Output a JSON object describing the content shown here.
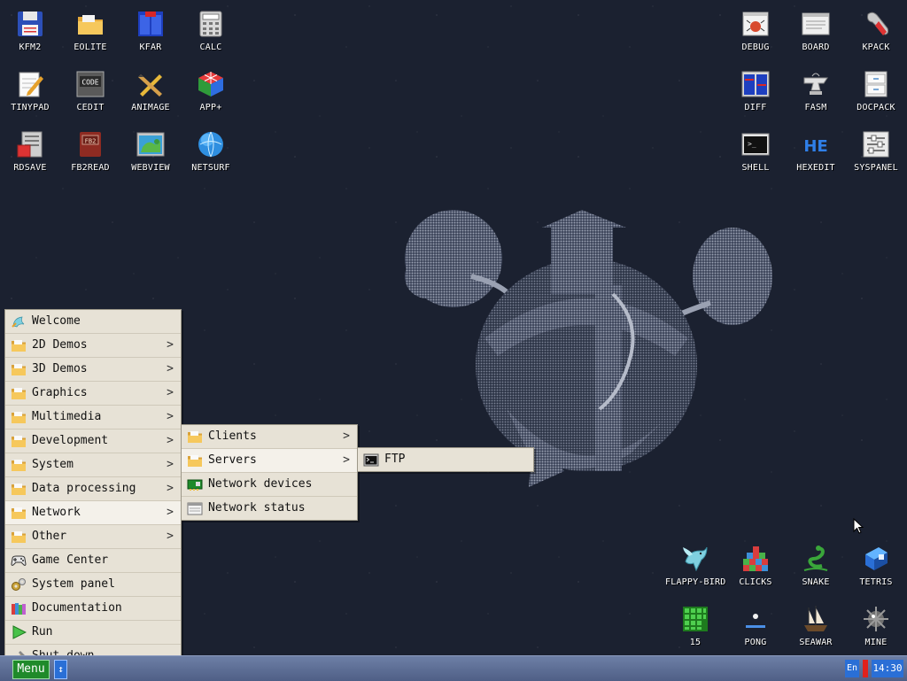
{
  "desktop_icons_left": [
    {
      "label": "KFM2",
      "icon": "floppy-icon",
      "name": "kfm2"
    },
    {
      "label": "EOLITE",
      "icon": "folder-icon",
      "name": "eolite"
    },
    {
      "label": "KFAR",
      "icon": "blue-panels-icon",
      "name": "kfar"
    },
    {
      "label": "CALC",
      "icon": "calculator-icon",
      "name": "calc"
    },
    {
      "label": "TINYPAD",
      "icon": "notepad-icon",
      "name": "tinypad"
    },
    {
      "label": "CEDIT",
      "icon": "code-icon",
      "name": "cedit"
    },
    {
      "label": "ANIMAGE",
      "icon": "pencil-ruler-icon",
      "name": "animage"
    },
    {
      "label": "APP+",
      "icon": "cube-icon",
      "name": "app-plus"
    },
    {
      "label": "RDSAVE",
      "icon": "ramdisk-save-icon",
      "name": "rdsave"
    },
    {
      "label": "FB2READ",
      "icon": "book-icon",
      "name": "fb2read"
    },
    {
      "label": "WEBVIEW",
      "icon": "web-map-icon",
      "name": "webview"
    },
    {
      "label": "NETSURF",
      "icon": "globe-icon",
      "name": "netsurf"
    }
  ],
  "desktop_icons_right": [
    {
      "label": "DEBUG",
      "icon": "bug-icon",
      "name": "debug"
    },
    {
      "label": "BOARD",
      "icon": "board-icon",
      "name": "board"
    },
    {
      "label": "KPACK",
      "icon": "wrench-icon",
      "name": "kpack"
    },
    {
      "label": "DIFF",
      "icon": "diff-icon",
      "name": "diff"
    },
    {
      "label": "FASM",
      "icon": "anvil-icon",
      "name": "fasm"
    },
    {
      "label": "DOCPACK",
      "icon": "cabinet-icon",
      "name": "docpack"
    },
    {
      "label": "SHELL",
      "icon": "terminal-icon",
      "name": "shell"
    },
    {
      "label": "HEXEDIT",
      "icon": "hex-icon",
      "name": "hexedit"
    },
    {
      "label": "SYSPANEL",
      "icon": "sliders-icon",
      "name": "syspanel"
    }
  ],
  "desktop_icons_games": [
    {
      "label": "FLAPPY-BIRD",
      "icon": "bird-icon",
      "name": "flappy-bird"
    },
    {
      "label": "CLICKS",
      "icon": "blocks-icon",
      "name": "clicks"
    },
    {
      "label": "SNAKE",
      "icon": "snake-icon",
      "name": "snake"
    },
    {
      "label": "TETRIS",
      "icon": "tetris-icon",
      "name": "tetris"
    },
    {
      "label": "15",
      "icon": "grid-puzzle-icon",
      "name": "fifteen"
    },
    {
      "label": "PONG",
      "icon": "pong-icon",
      "name": "pong"
    },
    {
      "label": "SEAWAR",
      "icon": "ship-icon",
      "name": "seawar"
    },
    {
      "label": "MINE",
      "icon": "mine-icon",
      "name": "mine"
    }
  ],
  "main_menu": [
    {
      "label": "Welcome",
      "icon": "welcome-icon",
      "submenu": false,
      "name": "welcome"
    },
    {
      "label": "2D Demos",
      "icon": "folder-icon",
      "submenu": true,
      "name": "2d-demos"
    },
    {
      "label": "3D Demos",
      "icon": "folder-icon",
      "submenu": true,
      "name": "3d-demos"
    },
    {
      "label": "Graphics",
      "icon": "folder-icon",
      "submenu": true,
      "name": "graphics"
    },
    {
      "label": "Multimedia",
      "icon": "folder-icon",
      "submenu": true,
      "name": "multimedia"
    },
    {
      "label": "Development",
      "icon": "folder-icon",
      "submenu": true,
      "name": "development"
    },
    {
      "label": "System",
      "icon": "folder-icon",
      "submenu": true,
      "name": "system"
    },
    {
      "label": "Data processing",
      "icon": "folder-icon",
      "submenu": true,
      "name": "data-processing"
    },
    {
      "label": "Network",
      "icon": "folder-icon",
      "submenu": true,
      "name": "network",
      "active": true
    },
    {
      "label": "Other",
      "icon": "folder-icon",
      "submenu": true,
      "name": "other"
    },
    {
      "label": "Game Center",
      "icon": "gamepad-icon",
      "submenu": false,
      "name": "game-center"
    },
    {
      "label": "System panel",
      "icon": "gears-icon",
      "submenu": false,
      "name": "system-panel"
    },
    {
      "label": "Documentation",
      "icon": "books-icon",
      "submenu": false,
      "name": "documentation"
    },
    {
      "label": "Run",
      "icon": "play-icon",
      "submenu": false,
      "name": "run"
    },
    {
      "label": "Shut down",
      "icon": "shutdown-icon",
      "submenu": false,
      "name": "shut-down"
    }
  ],
  "network_menu": [
    {
      "label": "Clients",
      "icon": "folder-icon",
      "submenu": true,
      "name": "clients"
    },
    {
      "label": "Servers",
      "icon": "folder-icon",
      "submenu": true,
      "name": "servers",
      "active": true
    },
    {
      "label": "Network devices",
      "icon": "network-card-icon",
      "submenu": false,
      "name": "network-devices"
    },
    {
      "label": "Network status",
      "icon": "status-window-icon",
      "submenu": false,
      "name": "network-status"
    }
  ],
  "servers_menu": [
    {
      "label": "FTP",
      "icon": "terminal-icon",
      "submenu": false,
      "name": "ftp"
    }
  ],
  "submenu_arrow": ">",
  "taskbar": {
    "menu_label": "Menu",
    "switch_glyph": "↕",
    "lang": "En",
    "clock": "14:30"
  },
  "colors": {
    "desktop": "#1b2130",
    "menu_bg": "#e7e2d6",
    "menu_active": "#f4f1ea",
    "taskbar": "#5a6b93",
    "menu_button": "#1f8a2a",
    "accent_blue": "#2a6fd6",
    "indicator_red": "#e0211c"
  }
}
